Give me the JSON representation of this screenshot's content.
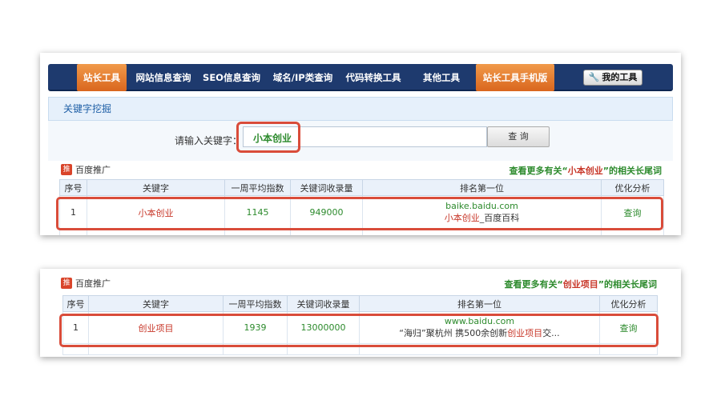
{
  "nav": {
    "items": [
      {
        "label": "站长工具",
        "active": true
      },
      {
        "label": "网站信息查询",
        "active": false
      },
      {
        "label": "SEO信息查询",
        "active": false
      },
      {
        "label": "域名/IP类查询",
        "active": false
      },
      {
        "label": "代码转换工具",
        "active": false
      },
      {
        "label": "其他工具",
        "active": false
      },
      {
        "label": "站长工具手机版",
        "active": true
      }
    ],
    "my_tools_label": "我的工具"
  },
  "section": {
    "title": "关键字挖掘"
  },
  "search": {
    "label": "请输入关键字：",
    "value": "小本创业",
    "button_label": "查 询"
  },
  "panel1": {
    "promo_badge": "推",
    "promo_text": "百度推广",
    "related_prefix": "查看更多有关“",
    "related_keyword": "小本创业",
    "related_suffix": "”的相关长尾词",
    "columns": [
      "序号",
      "关键字",
      "一周平均指数",
      "关键词收录量",
      "排名第一位",
      "优化分析"
    ],
    "row": {
      "index": "1",
      "keyword": "小本创业",
      "weekly_index": "1145",
      "indexed_count": "949000",
      "top_url": "baike.baidu.com",
      "top_title_highlight": "小本创业",
      "top_title_rest": "_百度百科",
      "action": "查询"
    }
  },
  "panel2": {
    "promo_badge": "推",
    "promo_text": "百度推广",
    "related_prefix": "查看更多有关“",
    "related_keyword": "创业项目",
    "related_suffix": "”的相关长尾词",
    "columns": [
      "序号",
      "关键字",
      "一周平均指数",
      "关键词收录量",
      "排名第一位",
      "优化分析"
    ],
    "row": {
      "index": "1",
      "keyword": "创业项目",
      "weekly_index": "1939",
      "indexed_count": "13000000",
      "top_url": "www.baidu.com",
      "top_title_prefix": "“海归”聚杭州 携500余创新",
      "top_title_highlight": "创业项目",
      "top_title_rest": "交...",
      "action": "查询"
    }
  },
  "colors": {
    "nav_bg": "#1e3a6e",
    "nav_active": "#e07a2e",
    "highlight_red": "#d94c3a",
    "text_green": "#2c8a2c",
    "text_red": "#c8382a"
  }
}
